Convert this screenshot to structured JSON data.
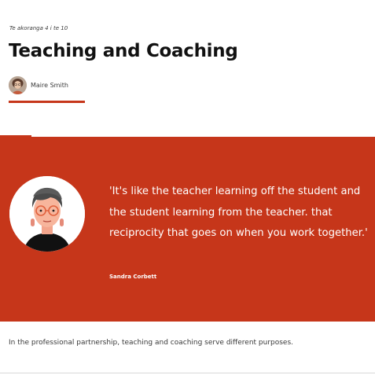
{
  "header": {
    "lesson_label": "Te akoranga 4 i te 10",
    "title": "Teaching and Coaching",
    "author_name": "Maire Smith"
  },
  "quote": {
    "text": "'It's like the teacher learning off the student and the student learning from the teacher. that reciprocity that goes on when you work together.'",
    "author": "Sandra Corbett"
  },
  "body": {
    "paragraph": "In the professional partnership, teaching and coaching serve different purposes."
  },
  "colors": {
    "accent": "#c6361a",
    "background": "#ffffff",
    "text": "#2b2b2b"
  }
}
